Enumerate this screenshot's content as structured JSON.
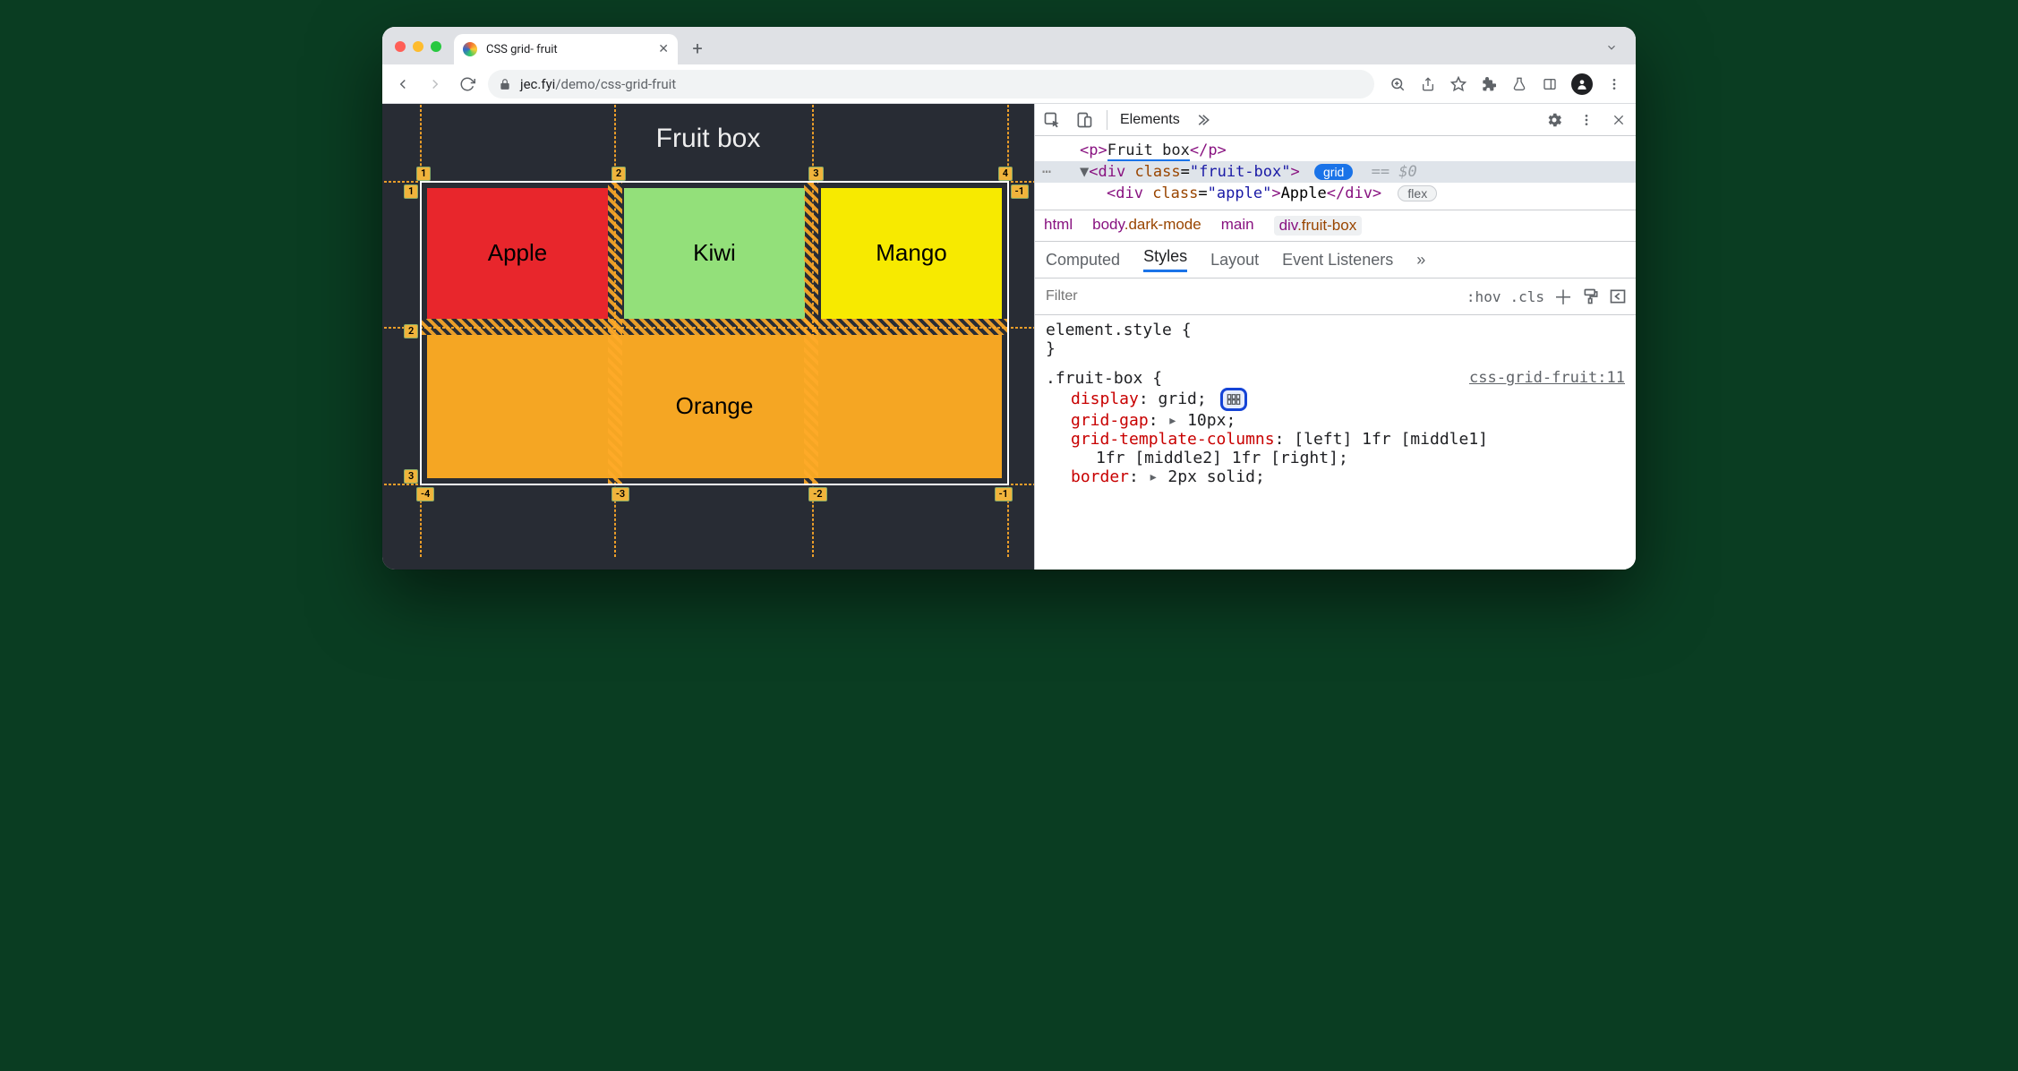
{
  "browser": {
    "tab_title": "CSS grid- fruit",
    "url_host": "jec.fyi",
    "url_path": "/demo/css-grid-fruit"
  },
  "page": {
    "heading": "Fruit box",
    "cells": {
      "apple": "Apple",
      "kiwi": "Kiwi",
      "mango": "Mango",
      "orange": "Orange"
    },
    "line_top": {
      "c1": "1",
      "c2": "2",
      "c3": "3",
      "c4": "4"
    },
    "line_left": {
      "r1": "1",
      "r2": "2",
      "r3": "3"
    },
    "line_right": {
      "r1": "-1"
    },
    "line_bottom": {
      "c1": "-4",
      "c2": "-3",
      "c3": "-2",
      "c4": "-1"
    }
  },
  "devtools": {
    "tabs": {
      "elements": "Elements"
    },
    "dom": {
      "p_text": "Fruit box",
      "div_class": "fruit-box",
      "grid_badge": "grid",
      "eq0": "== $0",
      "apple_class": "apple",
      "apple_text": "Apple",
      "flex_badge": "flex"
    },
    "crumbs": {
      "html": "html",
      "body": "body",
      "body_cls": ".dark-mode",
      "main": "main",
      "sel": "div",
      "sel_cls": ".fruit-box"
    },
    "subtabs": {
      "computed": "Computed",
      "styles": "Styles",
      "layout": "Layout",
      "events": "Event Listeners"
    },
    "filter": {
      "placeholder": "Filter",
      "hov": ":hov",
      "cls_": ".cls"
    },
    "styles": {
      "element_style_sel": "element.style {",
      "brace_close": "}",
      "rule_sel": ".fruit-box {",
      "rule_src": "css-grid-fruit:11",
      "p_display": "display",
      "v_display": "grid",
      "p_gap": "grid-gap",
      "v_gap": "10px",
      "p_cols": "grid-template-columns",
      "v_cols_1": "[left] 1fr [middle1]",
      "v_cols_2": "1fr [middle2] 1fr [right]",
      "p_border": "border",
      "v_border": "2px solid"
    }
  }
}
